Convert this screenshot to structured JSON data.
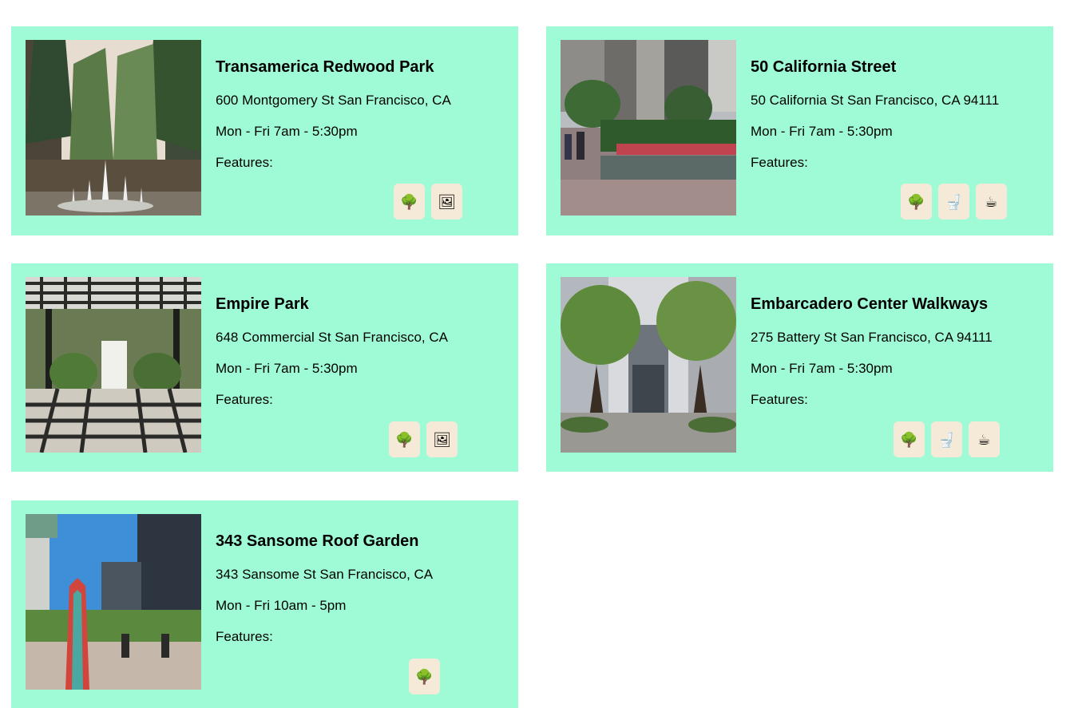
{
  "features_label": "Features:",
  "locations": [
    {
      "name": "Transamerica Redwood Park",
      "address": "600 Montgomery St San Francisco, CA",
      "hours": "Mon - Fri 7am - 5:30pm",
      "features": [
        "tree-icon",
        "picture-icon"
      ],
      "photo": "redwood-park-photo"
    },
    {
      "name": "50 California Street",
      "address": "50 California St San Francisco, CA 94111",
      "hours": "Mon - Fri 7am - 5:30pm",
      "features": [
        "tree-icon",
        "toilet-icon",
        "coffee-icon"
      ],
      "photo": "california-street-photo"
    },
    {
      "name": "Empire Park",
      "address": "648 Commercial St San Francisco, CA",
      "hours": "Mon - Fri 7am - 5:30pm",
      "features": [
        "tree-icon",
        "picture-icon"
      ],
      "photo": "empire-park-photo"
    },
    {
      "name": "Embarcadero Center Walkways",
      "address": "275 Battery St San Francisco, CA 94111",
      "hours": "Mon - Fri 7am - 5:30pm",
      "features": [
        "tree-icon",
        "toilet-icon",
        "coffee-icon"
      ],
      "photo": "embarcadero-photo"
    },
    {
      "name": "343 Sansome Roof Garden",
      "address": "343 Sansome St San Francisco, CA",
      "hours": "Mon - Fri 10am - 5pm",
      "features": [
        "tree-icon"
      ],
      "photo": "sansome-roof-photo"
    }
  ],
  "colors": {
    "card_background": "#9ffbd6",
    "chip_background": "#f5ead8"
  }
}
